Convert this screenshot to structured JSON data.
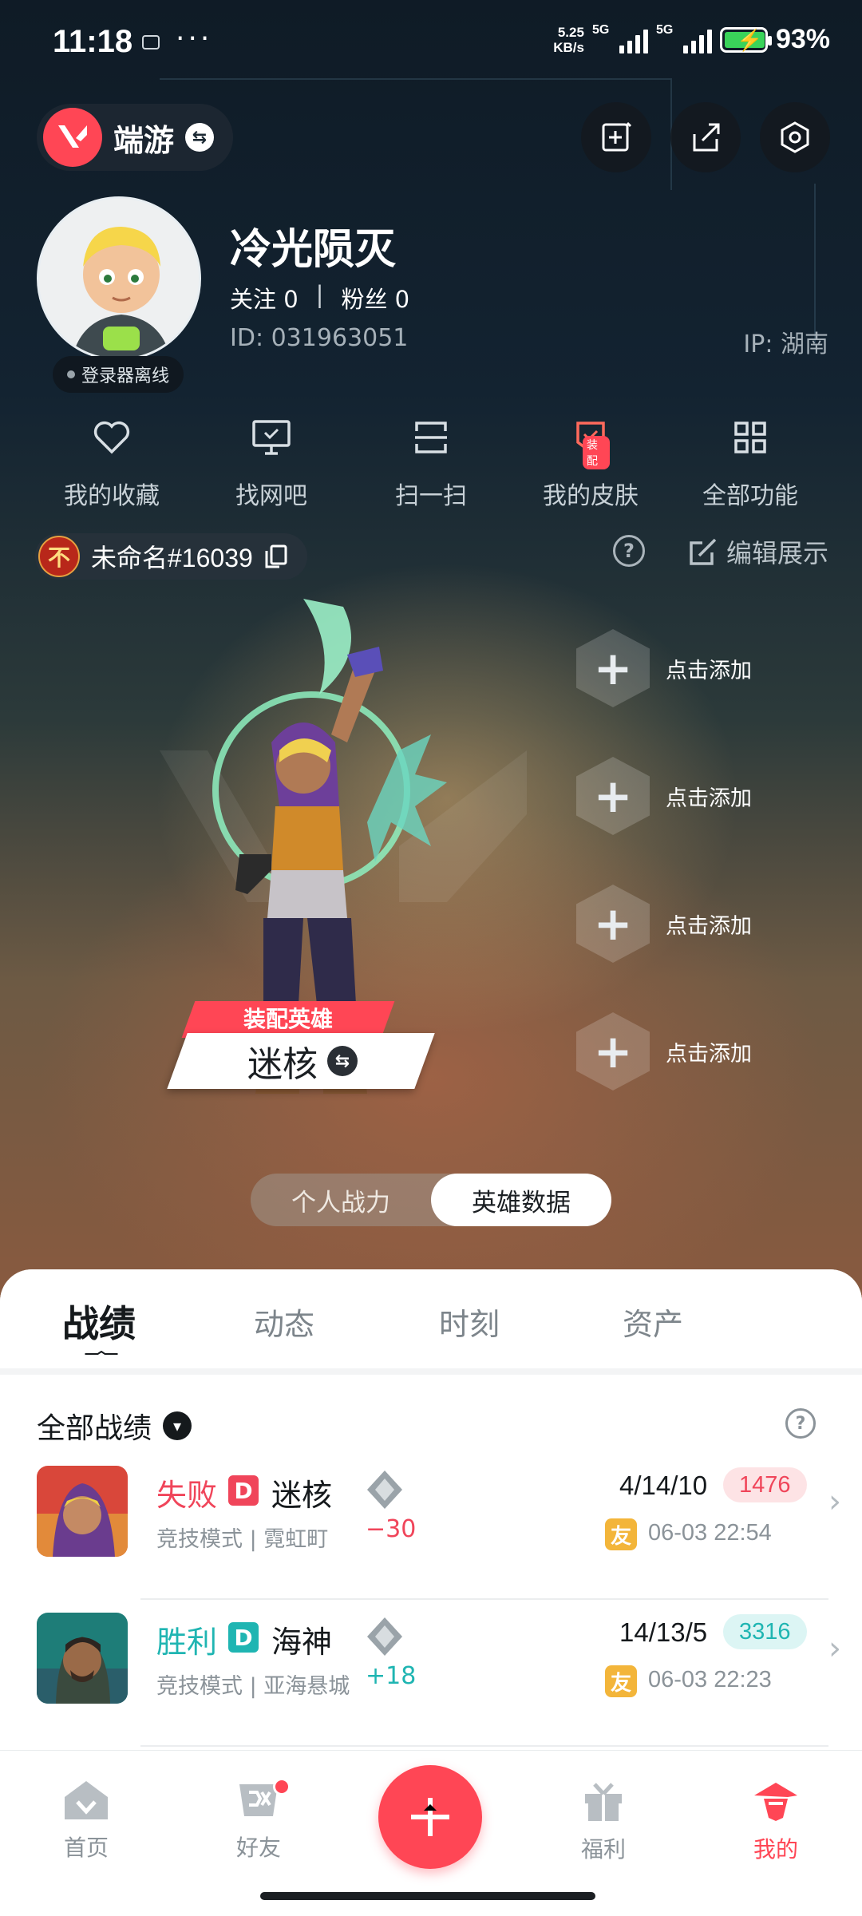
{
  "status_bar": {
    "time": "11:18",
    "dots": "···",
    "net_speed_value": "5.25",
    "net_speed_unit": "KB/s",
    "signal1_label": "5G",
    "signal2_label": "5G",
    "battery_percent": "93%"
  },
  "header": {
    "game_label": "端游"
  },
  "profile": {
    "nickname": "冷光陨灭",
    "follow_label": "关注 0",
    "separator": "|",
    "fans_label": "粉丝 0",
    "id_text": "ID: 031963051",
    "ip_text": "IP: 湖南",
    "offline_status": "登录器离线"
  },
  "functions": [
    {
      "label": "我的收藏",
      "icon": "heart-icon"
    },
    {
      "label": "找网吧",
      "icon": "monitor-icon"
    },
    {
      "label": "扫一扫",
      "icon": "scan-icon"
    },
    {
      "label": "我的皮肤",
      "icon": "skin-icon",
      "tag": "装配"
    },
    {
      "label": "全部功能",
      "icon": "grid-icon"
    }
  ],
  "account": {
    "name": "未命名#16039",
    "edit_display": "编辑展示"
  },
  "agent_showcase": {
    "equip_tag": "装配英雄",
    "agent_name": "迷核",
    "slots": [
      "点击添加",
      "点击添加",
      "点击添加",
      "点击添加"
    ],
    "toggle": {
      "personal": "个人战力",
      "hero": "英雄数据",
      "active": "hero"
    }
  },
  "tabs": {
    "items": [
      "战绩",
      "动态",
      "时刻",
      "资产"
    ],
    "active": "战绩"
  },
  "records": {
    "header": "全部战绩",
    "matches": [
      {
        "result": "失败",
        "rank_letter": "D",
        "agent": "迷核",
        "mode": "竞技模式 | 霓虹町",
        "delta": "−30",
        "kda": "4/14/10",
        "score": "1476",
        "friend_tag": "友",
        "time": "06-03 22:54",
        "result_color": "#f0455a"
      },
      {
        "result": "胜利",
        "rank_letter": "D",
        "agent": "海神",
        "mode": "竞技模式 | 亚海悬城",
        "delta": "+18",
        "kda": "14/13/5",
        "score": "3316",
        "friend_tag": "友",
        "time": "06-03 22:23",
        "result_color": "#1fb5b2"
      }
    ]
  },
  "bottom_nav": {
    "home": "首页",
    "friends": "好友",
    "benefits": "福利",
    "mine": "我的",
    "active": "mine"
  },
  "colors": {
    "accent": "#ff4655",
    "lose": "#f0455a",
    "win": "#1fb5b2"
  }
}
